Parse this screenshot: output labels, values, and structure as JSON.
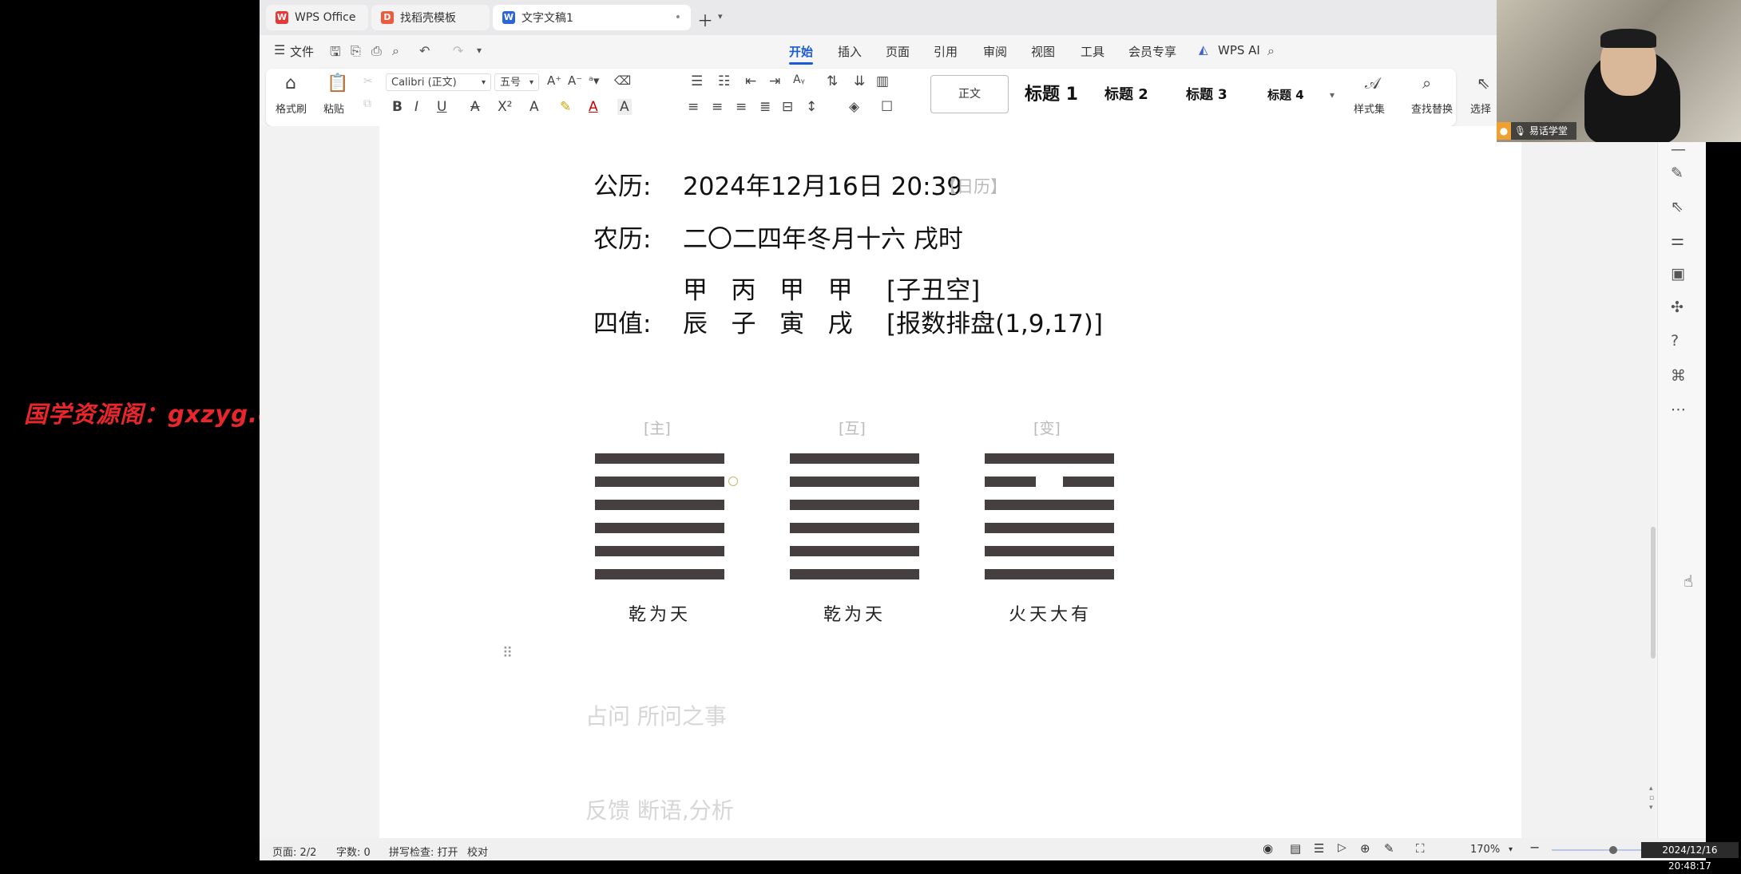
{
  "watermark": "国学资源阁：gxzyg.cn",
  "tabs": [
    {
      "label": "WPS Office",
      "icon": "wps-logo-icon"
    },
    {
      "label": "找稻壳模板",
      "icon": "docer-icon"
    },
    {
      "label": "文字文稿1",
      "icon": "word-doc-icon"
    }
  ],
  "menu": {
    "file": "文件",
    "items": [
      "开始",
      "插入",
      "页面",
      "引用",
      "审阅",
      "视图",
      "工具",
      "会员专享"
    ],
    "active": "开始",
    "ai": "WPS AI"
  },
  "ribbon": {
    "format_painter": "格式刷",
    "paste": "粘贴",
    "font_name": "Calibri (正文)",
    "font_size": "五号",
    "styles": [
      "正文",
      "标题 1",
      "标题 2",
      "标题 3",
      "标题 4"
    ],
    "style_set": "样式集",
    "find_replace": "查找替换",
    "select": "选择"
  },
  "document": {
    "gregorian_label": "公历:",
    "gregorian_value": "2024年12月16日 20:39",
    "gregorian_tag": "【日历】",
    "lunar_label": "农历:",
    "lunar_value": "二〇二四年冬月十六 戌时",
    "stems_row": "甲   丙   甲   甲",
    "empty_note": "[子丑空]",
    "pillars_label": "四值:",
    "branches_row": "辰   子   寅   戌",
    "method_note": "[报数排盘(1,9,17)]",
    "hexagrams": [
      {
        "tag": "[主]",
        "name": "乾为天",
        "lines": [
          "yang",
          "yang",
          "yang",
          "yang",
          "yang",
          "yang"
        ]
      },
      {
        "tag": "[互]",
        "name": "乾为天",
        "lines": [
          "yang",
          "yang",
          "yang",
          "yang",
          "yang",
          "yang"
        ]
      },
      {
        "tag": "[变]",
        "name": "火天大有",
        "lines": [
          "yang",
          "yin",
          "yang",
          "yang",
          "yang",
          "yang"
        ]
      }
    ],
    "question_placeholder": "占问 所问之事",
    "feedback_placeholder": "反馈 断语,分析"
  },
  "status": {
    "page": "页面: 2/2",
    "words": "字数: 0",
    "spell": "拼写检查: 打开",
    "proof": "校对",
    "zoom": "170%"
  },
  "webcam": {
    "label": "易话学堂"
  },
  "clock": "2024/12/16 20:48:17",
  "colors": {
    "accent": "#1a5bd6",
    "watermark": "#e8262c",
    "hexagram_bar": "#45403f"
  }
}
